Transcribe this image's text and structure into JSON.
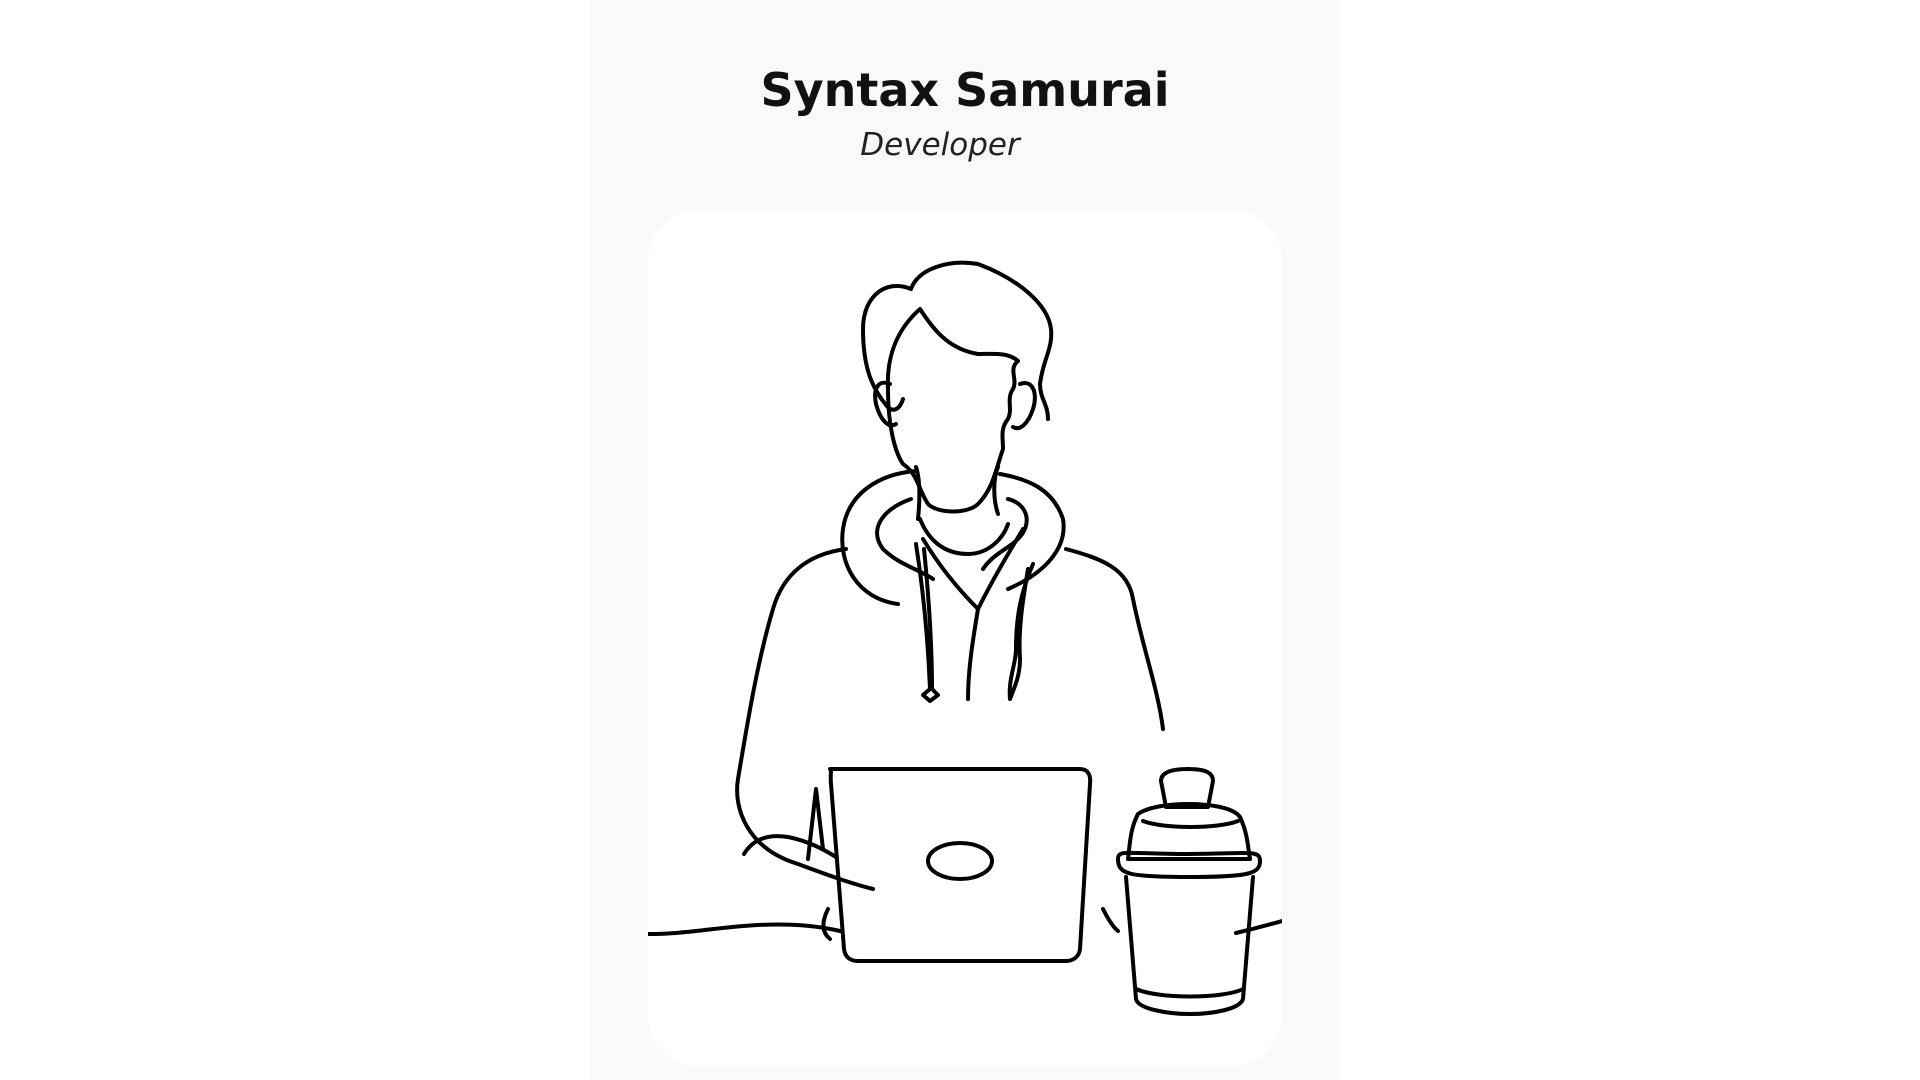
{
  "profile": {
    "name": "Syntax Samurai",
    "role": "Developer"
  },
  "illustration": {
    "subject": "developer-at-laptop",
    "stroke_color": "#000000",
    "card_color": "#ffffff",
    "panel_color": "#f9f9f9"
  }
}
